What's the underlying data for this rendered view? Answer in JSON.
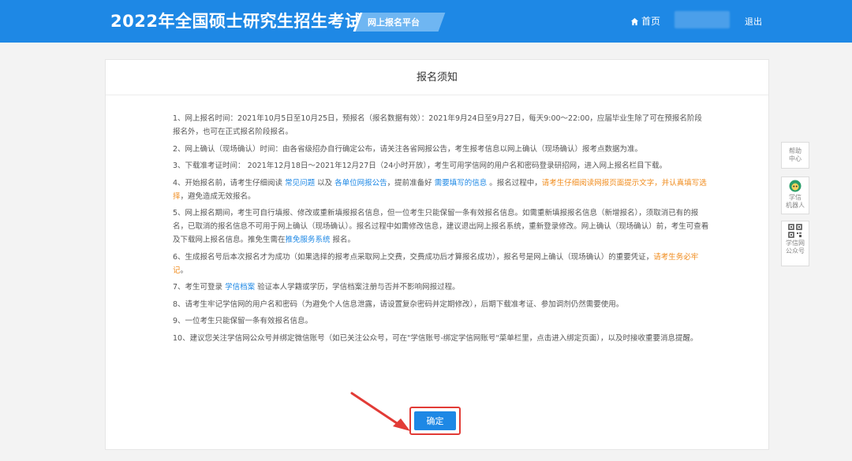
{
  "header": {
    "title": "2022年全国硕士研究生招生考试",
    "platform": "网上报名平台",
    "home": "首页",
    "logout": "退出"
  },
  "notice": {
    "title": "报名须知",
    "items": {
      "i1": "1、网上报名时间：2021年10月5日至10月25日，预报名（报名数据有效）：2021年9月24日至9月27日，每天9:00～22:00，应届毕业生除了可在预报名阶段报名外，也可在正式报名阶段报名。",
      "i2": "2、网上确认（现场确认）时间：由各省级招办自行确定公布，请关注各省网报公告，考生报考信息以网上确认（现场确认）报考点数据为准。",
      "i3": "3、下载准考证时间： 2021年12月18日～2021年12月27日（24小时开放），考生可用学信网的用户名和密码登录研招网，进入网上报名栏目下载。",
      "i4_a": "4、开始报名前，请考生仔细阅读 ",
      "i4_link1": "常见问题",
      "i4_b": " 以及 ",
      "i4_link2": "各单位网报公告",
      "i4_c": "，提前准备好 ",
      "i4_link3": "需要填写的信息",
      "i4_d": " 。报名过程中，",
      "i4_orange": "请考生仔细阅读网报页面提示文字，并认真填写选择",
      "i4_e": "，避免造成无效报名。",
      "i5_a": "5、网上报名期间，考生可自行填报、修改或重新填报报名信息，但一位考生只能保留一条有效报名信息。如需重新填报报名信息（新增报名），须取消已有的报名，已取消的报名信息不可用于网上确认（现场确认）。报名过程中如需修改信息，建议退出网上报名系统，重新登录修改。网上确认（现场确认）前，考生可查看及下载网上报名信息。推免生需在",
      "i5_link": "推免服务系统",
      "i5_b": " 报名。",
      "i6_a": "6、生成报名号后本次报名才为成功（如果选择的报考点采取网上交费，交费成功后才算报名成功），报名号是网上确认（现场确认）的重要凭证，",
      "i6_orange": "请考生务必牢记",
      "i6_b": "。",
      "i7_a": "7、考生可登录 ",
      "i7_link": "学信档案",
      "i7_b": " 验证本人学籍或学历，学信档案注册与否并不影响网报过程。",
      "i8": "8、请考生牢记学信网的用户名和密码（为避免个人信息泄露，请设置复杂密码并定期修改），后期下载准考证、参加调剂仍然需要使用。",
      "i9": "9、一位考生只能保留一条有效报名信息。",
      "i10": "10、建议您关注学信网公众号并绑定微信账号（如已关注公众号，可在\"学信账号-绑定学信网账号\"菜单栏里，点击进入绑定页面），以及时接收重要消息提醒。"
    },
    "confirm": "确定"
  },
  "side": {
    "help": [
      "帮助",
      "中心"
    ],
    "robot": [
      "学信",
      "机器人"
    ],
    "wechat": [
      "学信网",
      "公众号"
    ]
  },
  "colors": {
    "brand": "#1e88e5",
    "highlight": "#f08c1e",
    "annotation": "#e23b36"
  }
}
